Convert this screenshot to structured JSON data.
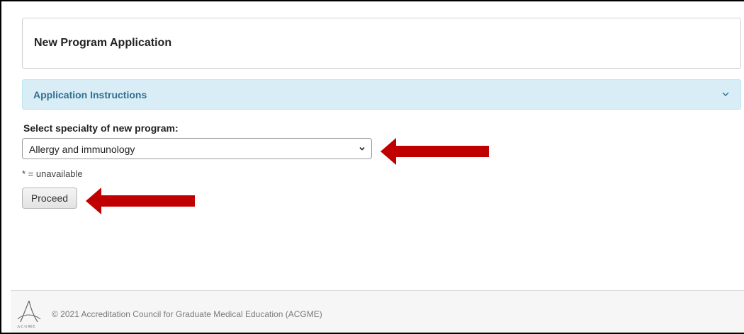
{
  "title_panel": {
    "title": "New Program Application"
  },
  "instructions": {
    "label": "Application Instructions",
    "expanded": false
  },
  "specialty": {
    "label": "Select specialty of new program:",
    "selected": "Allergy and immunology"
  },
  "note": "* = unavailable",
  "proceed_label": "Proceed",
  "footer": {
    "logo_text": "ACGME",
    "copyright": "© 2021 Accreditation Council for Graduate Medical Education (ACGME)"
  },
  "colors": {
    "arrow": "#c00000",
    "instructions_bg": "#d9edf7",
    "instructions_text": "#31708f"
  },
  "icons": {
    "instructions_toggle": "chevron-down-icon",
    "select_toggle": "chevron-down-icon"
  }
}
